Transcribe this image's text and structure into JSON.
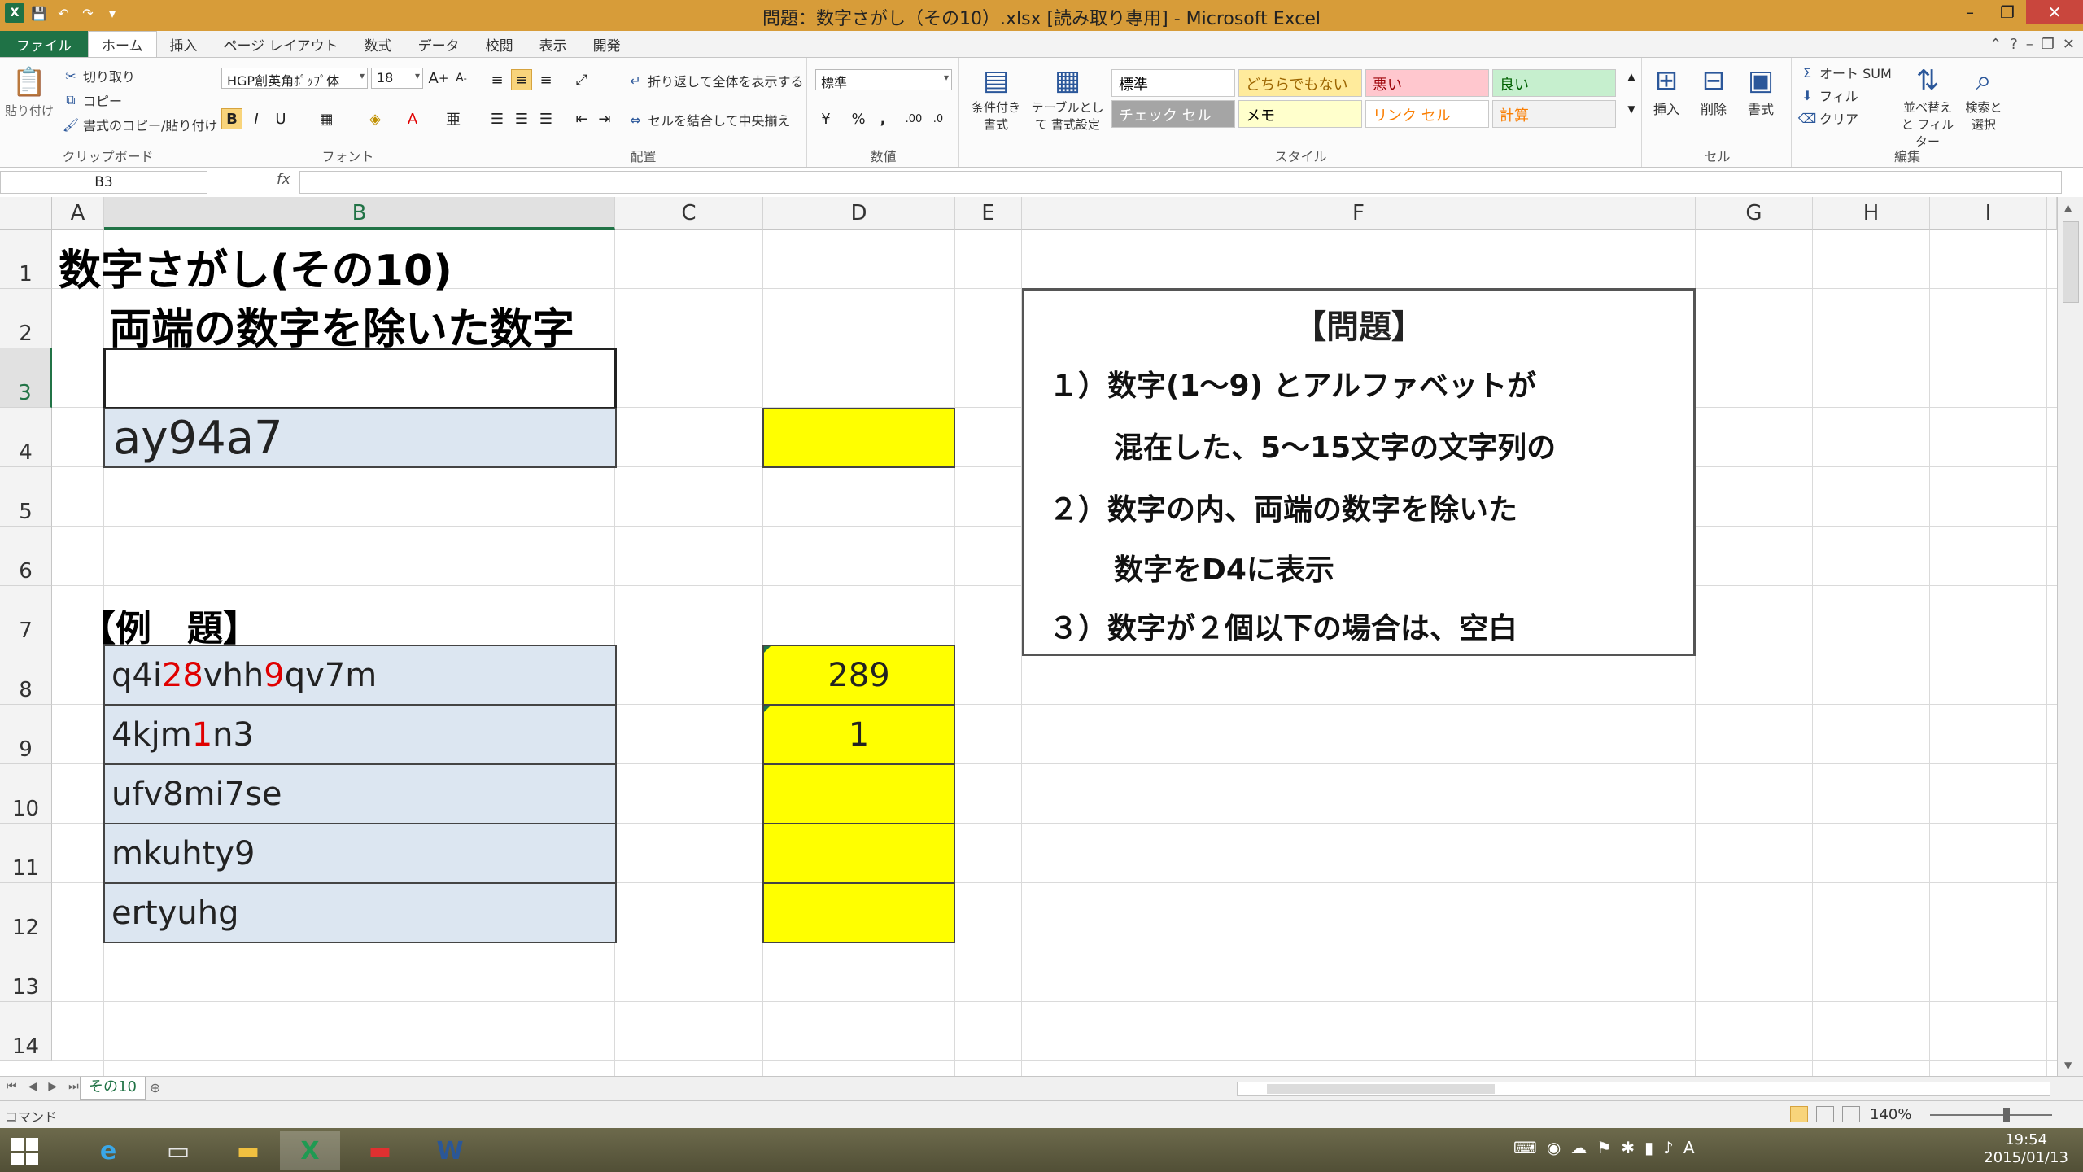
{
  "window": {
    "title": "問題：数字さがし（その10）.xlsx  [読み取り専用] - Microsoft Excel",
    "controls": [
      "–",
      "❐",
      "✕"
    ]
  },
  "ribbon_tabs": [
    "ファイル",
    "ホーム",
    "挿入",
    "ページ レイアウト",
    "数式",
    "データ",
    "校閲",
    "表示",
    "開発"
  ],
  "ribbon": {
    "clipboard": {
      "paste": "貼り付け",
      "cut": "切り取り",
      "copy": "コピー",
      "format_painter": "書式のコピー/貼り付け",
      "label": "クリップボード"
    },
    "font": {
      "name": "HGP創英角ﾎﾟｯﾌﾟ体",
      "size": "18",
      "bold": "B",
      "italic": "I",
      "underline": "U",
      "label": "フォント"
    },
    "alignment": {
      "wrap": "折り返して全体を表示する",
      "merge": "セルを結合して中央揃え",
      "label": "配置"
    },
    "number": {
      "format": "標準",
      "percent": "%",
      "comma": ",",
      "label": "数値"
    },
    "styles": {
      "conditional": "条件付き 書式",
      "table": "テーブルとして 書式設定",
      "cells": [
        {
          "text": "標準",
          "bg": "#ffffff",
          "color": "#000000"
        },
        {
          "text": "どちらでもない",
          "bg": "#ffeb9c",
          "color": "#9c6500"
        },
        {
          "text": "悪い",
          "bg": "#ffc7ce",
          "color": "#9c0006"
        },
        {
          "text": "良い",
          "bg": "#c6efce",
          "color": "#006100"
        },
        {
          "text": "チェック セル",
          "bg": "#a5a5a5",
          "color": "#ffffff"
        },
        {
          "text": "メモ",
          "bg": "#ffffcc",
          "color": "#000000"
        },
        {
          "text": "リンク セル",
          "bg": "#ffffff",
          "color": "#fa7d00"
        },
        {
          "text": "計算",
          "bg": "#f2f2f2",
          "color": "#fa7d00"
        }
      ],
      "label": "スタイル"
    },
    "cells": {
      "insert": "挿入",
      "delete": "削除",
      "format": "書式",
      "label": "セル"
    },
    "editing": {
      "autosum": "オート SUM",
      "fill": "フィル",
      "clear": "クリア",
      "sort": "並べ替えと フィルター",
      "find": "検索と 選択",
      "label": "編集"
    }
  },
  "formula_bar": {
    "name_box": "B3",
    "fx": "fx",
    "content": ""
  },
  "columns": [
    "A",
    "B",
    "C",
    "D",
    "E",
    "F",
    "G",
    "H",
    "I"
  ],
  "rows": [
    "1",
    "2",
    "3",
    "4",
    "5",
    "6",
    "7",
    "8",
    "9",
    "10",
    "11",
    "12",
    "13",
    "14"
  ],
  "sheet": {
    "title": "数字さがし(その10)",
    "subtitle": "両端の数字を除いた数字",
    "input_value": "ay94a7",
    "example_label": "【例　題】",
    "examples": [
      {
        "parts": [
          {
            "t": "q4i",
            "red": false
          },
          {
            "t": "28",
            "red": true
          },
          {
            "t": "vhh",
            "red": false
          },
          {
            "t": "9",
            "red": true
          },
          {
            "t": "qv7m",
            "red": false
          }
        ],
        "result": "289"
      },
      {
        "parts": [
          {
            "t": "4kjm",
            "red": false
          },
          {
            "t": "1",
            "red": true
          },
          {
            "t": "n3",
            "red": false
          }
        ],
        "result": "1"
      },
      {
        "parts": [
          {
            "t": "ufv8mi7se",
            "red": false
          }
        ],
        "result": ""
      },
      {
        "parts": [
          {
            "t": "mkuhty9",
            "red": false
          }
        ],
        "result": ""
      },
      {
        "parts": [
          {
            "t": "ertyuhg",
            "red": false
          }
        ],
        "result": ""
      }
    ],
    "problem": {
      "title": "【問題】",
      "lines": [
        "１）数字(1～9) とアルファベットが",
        "混在した、5～15文字の文字列の",
        "２）数字の内、両端の数字を除いた",
        "数字をD4に表示",
        "３）数字が２個以下の場合は、空白"
      ]
    }
  },
  "sheet_tab": "その10",
  "status": {
    "mode": "コマンド",
    "zoom": "140%"
  },
  "taskbar": {
    "time": "19:54",
    "date": "2015/01/13"
  },
  "colors": {
    "excel_green": "#217346",
    "input_fill": "#dce6f1",
    "answer_fill": "#ffff00",
    "highlight_red": "#e00000",
    "title_bar": "#d79c39"
  }
}
